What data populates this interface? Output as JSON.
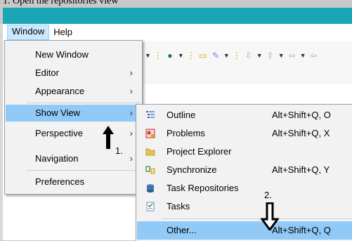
{
  "caption": "1. Open the repositories view",
  "menubar": {
    "items": [
      {
        "label": "Window"
      },
      {
        "label": "Help"
      }
    ]
  },
  "window_menu": {
    "items": [
      {
        "label": "New Window",
        "has_submenu": false
      },
      {
        "label": "Editor",
        "has_submenu": true
      },
      {
        "label": "Appearance",
        "has_submenu": true
      },
      {
        "label": "Show View",
        "has_submenu": true,
        "highlighted": true
      },
      {
        "label": "Perspective",
        "has_submenu": true
      },
      {
        "label": "Navigation",
        "has_submenu": true
      },
      {
        "label": "Preferences",
        "has_submenu": false
      }
    ]
  },
  "show_view_submenu": {
    "items": [
      {
        "label": "Outline",
        "shortcut": "Alt+Shift+Q, O",
        "icon": "outline-icon"
      },
      {
        "label": "Problems",
        "shortcut": "Alt+Shift+Q, X",
        "icon": "problems-icon"
      },
      {
        "label": "Project Explorer",
        "shortcut": "",
        "icon": "project-explorer-icon"
      },
      {
        "label": "Synchronize",
        "shortcut": "Alt+Shift+Q, Y",
        "icon": "synchronize-icon"
      },
      {
        "label": "Task Repositories",
        "shortcut": "",
        "icon": "task-repositories-icon"
      },
      {
        "label": "Tasks",
        "shortcut": "",
        "icon": "tasks-icon"
      },
      {
        "label": "Other...",
        "shortcut": "Alt+Shift+Q, Q",
        "icon": "",
        "highlighted": true
      }
    ]
  },
  "annotations": {
    "step1": "1.",
    "step2": "2."
  },
  "colors": {
    "accent_bar": "#1aa6b4",
    "highlight": "#91c9f7",
    "menu_bg": "#f2f2f2"
  }
}
